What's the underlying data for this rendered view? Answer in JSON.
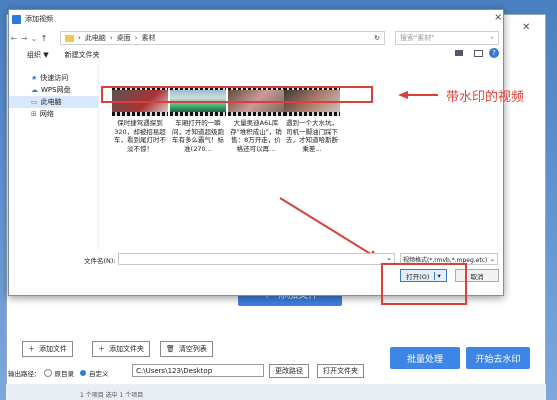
{
  "colors": {
    "accent": "#3d86e6",
    "annotation": "#e0453c"
  },
  "dialog": {
    "title": "添加视频",
    "close_label": "×",
    "nav": {
      "back": "←",
      "forward": "→",
      "up": "↑",
      "recent": "⌄",
      "breadcrumb": [
        "此电脑",
        "桌面",
        "素材"
      ],
      "refresh": "↻",
      "search_placeholder": "搜索\"素材\""
    },
    "toolbar": {
      "organize": "组织 ▼",
      "new_folder": "新建文件夹"
    },
    "sidebar": [
      {
        "label": "快速访问",
        "icon": "star-icon"
      },
      {
        "label": "WPS网盘",
        "icon": "cloud-icon"
      },
      {
        "label": "此电脑",
        "icon": "computer-icon"
      },
      {
        "label": "网络",
        "icon": "network-icon"
      }
    ],
    "files": [
      {
        "name": "保时捷驾遇探到320，却被招易超车，看到尾灯时不淡不惊！"
      },
      {
        "name": "车厢打开的一瞬间，才知道超级跑车有多么霸气！标准(270..."
      },
      {
        "name": "大量奥迪A6L库存\"堆积成山\"，销售：8万开走，价格还可以再..."
      },
      {
        "name": "遇到一个大水坑，司机一脚油门踩下去，才知道哈斯断乘差..."
      }
    ],
    "filename_label": "文件名(N):",
    "filename_value": "",
    "filetype": "视频格式(*.rmvb,*.mpeg.etc)",
    "open_label": "打开(O)",
    "cancel_label": "取消"
  },
  "annotation": {
    "text": "带水印的视频"
  },
  "app": {
    "close_label": "✕",
    "add_file_big": "添加文件",
    "add_file": "添加文件",
    "add_folder": "添加文件夹",
    "clear_list": "清空列表",
    "output_label": "输出路径：",
    "radio_original": "原目录",
    "radio_custom": "自定义",
    "output_path": "C:\\Users\\123\\Desktop",
    "change_path": "更改路径",
    "open_folder": "打开文件夹",
    "batch_process": "批量处理",
    "start_remove": "开始去水印",
    "footer": "1 个项目    选中 1 个项目"
  }
}
